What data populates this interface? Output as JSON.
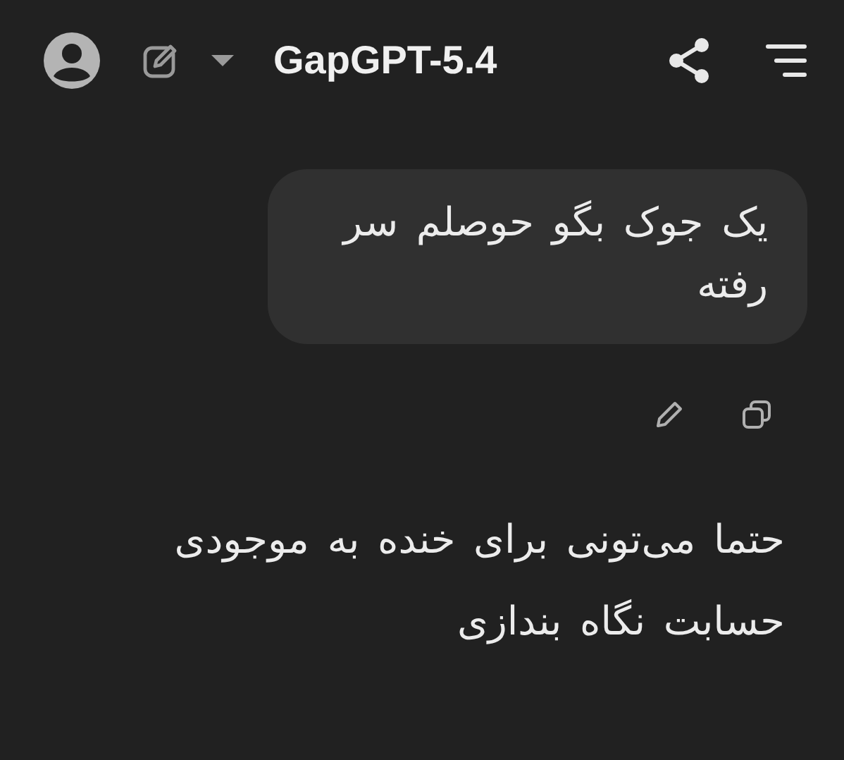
{
  "header": {
    "title": "GapGPT-5.4"
  },
  "messages": [
    {
      "kind": "user",
      "text": "یک جوک بگو حوصلم سر رفته"
    },
    {
      "kind": "assistant",
      "text": "حتما می‌تونی برای خنده به موجودی حسابت نگاه بندازی"
    }
  ]
}
